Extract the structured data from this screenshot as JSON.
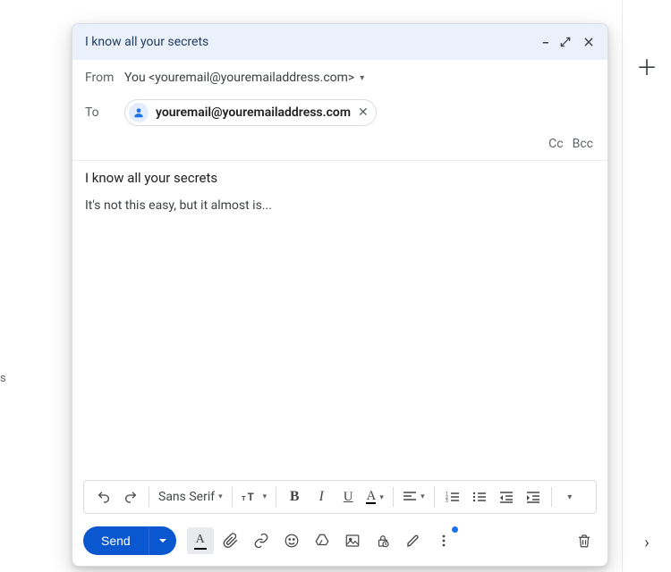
{
  "right_bar": {
    "plus_label": "＋",
    "chevron_label": "›"
  },
  "stray_text": "s",
  "header": {
    "title": "I know all your secrets"
  },
  "from": {
    "label": "From",
    "value": "You <youremail@youremailaddress.com>"
  },
  "to": {
    "label": "To",
    "chip": {
      "email": "youremail@youremailaddress.com"
    }
  },
  "cc_label": "Cc",
  "bcc_label": "Bcc",
  "subject": "I know all your secrets",
  "body_text": "It's not this easy, but it almost is...",
  "format": {
    "font": "Sans Serif",
    "bold": "B",
    "italic": "I",
    "underline": "U",
    "color_letter": "A"
  },
  "send": {
    "label": "Send"
  },
  "bottom": {
    "text_color_letter": "A"
  }
}
